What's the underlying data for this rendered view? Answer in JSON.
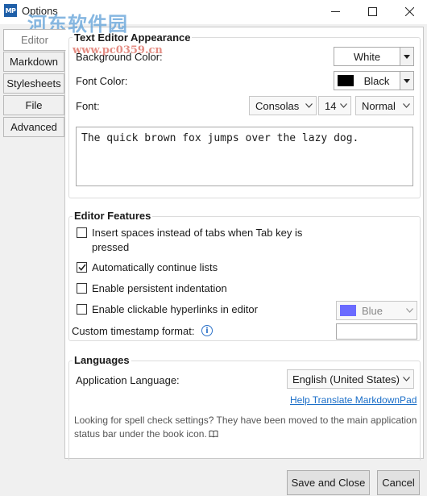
{
  "window": {
    "title": "Options",
    "app_icon": "MP",
    "watermark": "河东软件园",
    "watermark_url": "www.pc0359.cn",
    "controls": {
      "minimize_icon": "minimize-icon",
      "maximize_icon": "maximize-icon",
      "close_icon": "close-icon"
    }
  },
  "tabs": [
    {
      "label": "Editor",
      "active": true
    },
    {
      "label": "Markdown"
    },
    {
      "label": "Stylesheets"
    },
    {
      "label": "File"
    },
    {
      "label": "Advanced"
    }
  ],
  "appearance": {
    "title": "Text Editor Appearance",
    "background_color_label": "Background Color:",
    "background_color_value": "White",
    "font_color_label": "Font Color:",
    "font_color_value": "Black",
    "font_color_swatch": "#000000",
    "font_label": "Font:",
    "font_family": "Consolas",
    "font_size": "14",
    "font_weight": "Normal",
    "preview_text": "The quick brown fox jumps over the lazy dog."
  },
  "features": {
    "title": "Editor Features",
    "items": [
      {
        "label": "Insert spaces instead of tabs when Tab key is pressed",
        "checked": false
      },
      {
        "label": "Automatically continue lists",
        "checked": true
      },
      {
        "label": "Enable persistent indentation",
        "checked": false
      },
      {
        "label": "Enable clickable hyperlinks in editor",
        "checked": false
      }
    ],
    "hyperlink_color": "Blue",
    "hyperlink_color_swatch": "#6b6bff",
    "timestamp_label": "Custom timestamp format:",
    "timestamp_value": ""
  },
  "languages": {
    "title": "Languages",
    "app_language_label": "Application Language:",
    "app_language_value": "English (United States)",
    "translate_link": "Help Translate MarkdownPad",
    "note": "Looking for spell check settings? They have been moved to the main application status bar under the book icon."
  },
  "footer": {
    "save_label": "Save and Close",
    "cancel_label": "Cancel"
  }
}
